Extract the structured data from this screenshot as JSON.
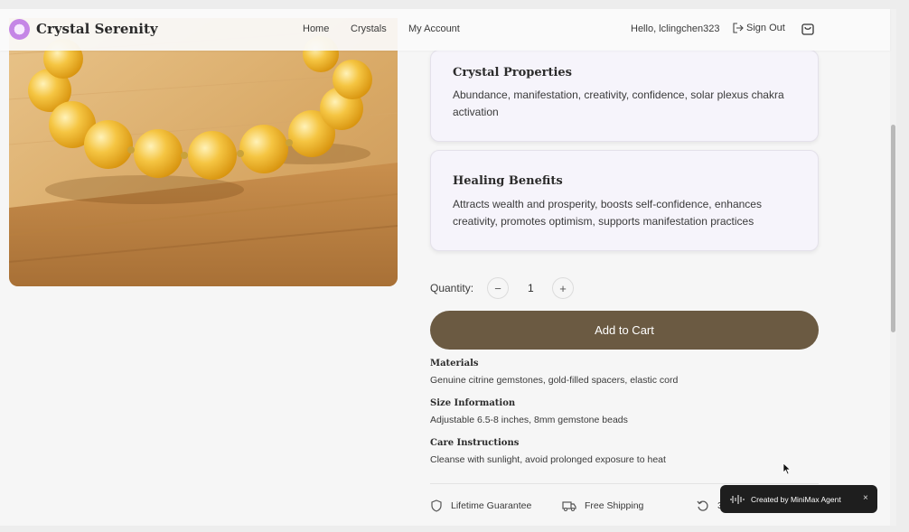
{
  "header": {
    "brand": "Crystal Serenity",
    "nav": [
      "Home",
      "Crystals",
      "My Account"
    ],
    "greeting": "Hello, lclingchen323",
    "sign_out": "Sign Out"
  },
  "cards": [
    {
      "title": "Crystal Properties",
      "body": "Abundance, manifestation, creativity, confidence, solar plexus chakra activation"
    },
    {
      "title": "Healing Benefits",
      "body": "Attracts wealth and prosperity, boosts self-confidence, enhances creativity, promotes optimism, supports manifestation practices"
    }
  ],
  "quantity": {
    "label": "Quantity:",
    "value": "1",
    "minus": "−",
    "plus": "+"
  },
  "add_to_cart": "Add to Cart",
  "details": [
    {
      "heading": "Materials",
      "text": "Genuine citrine gemstones, gold-filled spacers, elastic cord"
    },
    {
      "heading": "Size Information",
      "text": "Adjustable 6.5-8 inches, 8mm gemstone beads"
    },
    {
      "heading": "Care Instructions",
      "text": "Cleanse with sunlight, avoid prolonged exposure to heat"
    }
  ],
  "badges": [
    "Lifetime Guarantee",
    "Free Shipping",
    "3"
  ],
  "toast": {
    "text": "Created by MiniMax Agent",
    "close": "×"
  },
  "colors": {
    "accent": "#6b5a42",
    "card_bg": "#f6f4fb"
  },
  "icons": {
    "brand": "crystal-logo-icon",
    "sign_out": "sign-out-icon",
    "cart": "shopping-bag-icon",
    "guarantee": "shield-icon",
    "shipping": "truck-icon",
    "returns": "rotate-icon"
  }
}
